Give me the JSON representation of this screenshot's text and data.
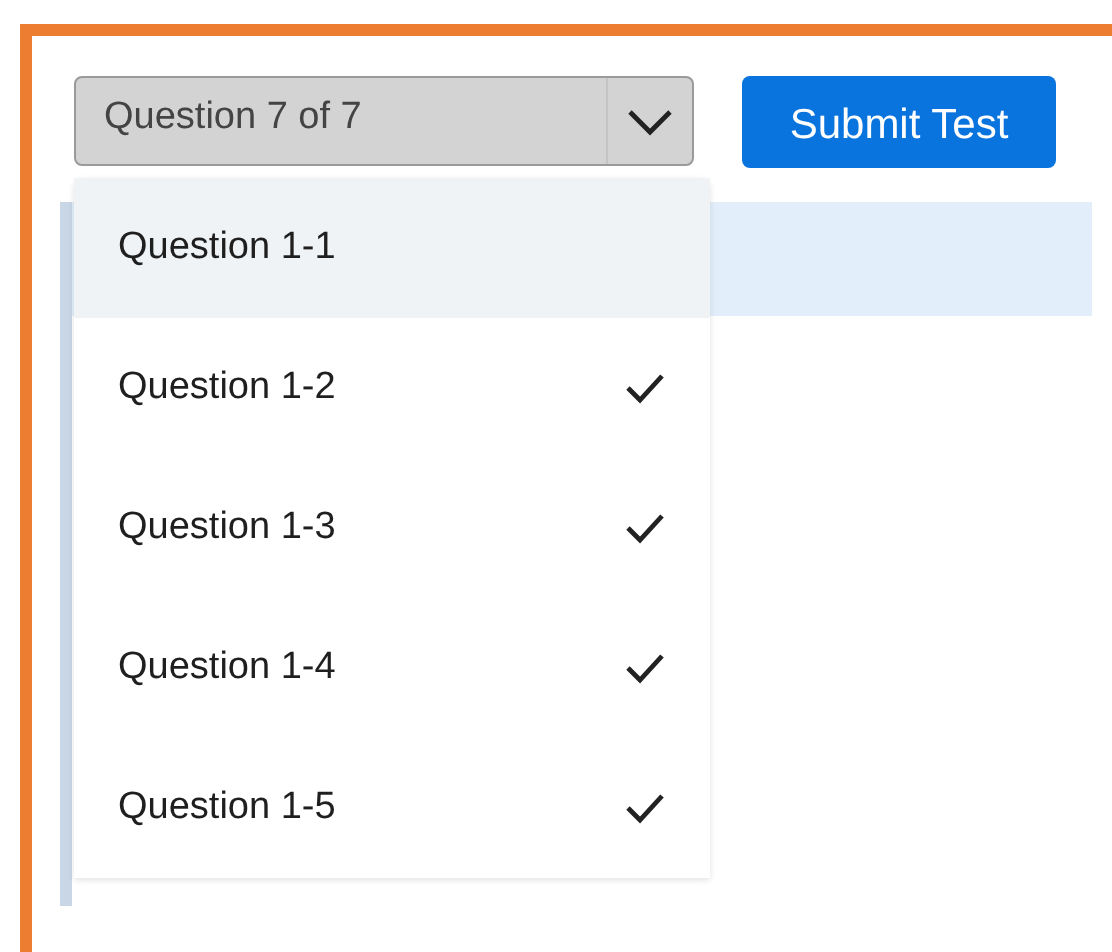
{
  "toolbar": {
    "question_select": {
      "value": "Question 7 of 7",
      "expanded": true
    },
    "submit_button": "Submit Test"
  },
  "question_menu": {
    "items": [
      {
        "label": "Question 1-1",
        "selected": true,
        "checked": false
      },
      {
        "label": "Question 1-2",
        "selected": false,
        "checked": true
      },
      {
        "label": "Question 1-3",
        "selected": false,
        "checked": true
      },
      {
        "label": "Question 1-4",
        "selected": false,
        "checked": true
      },
      {
        "label": "Question 1-5",
        "selected": false,
        "checked": true
      }
    ]
  }
}
